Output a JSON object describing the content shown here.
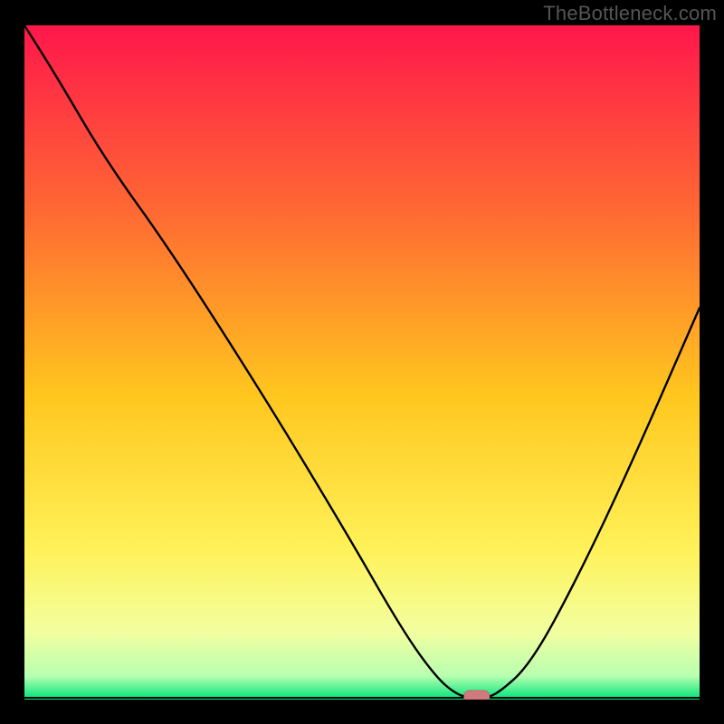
{
  "watermark": "TheBottleneck.com",
  "colors": {
    "page_bg": "#000000",
    "gradient_top": "#ff1f4b",
    "gradient_mid": "#ffd500",
    "gradient_low": "#f3ff8a",
    "gradient_green": "#00e37a",
    "curve": "#000000",
    "marker_fill": "#d07a7d",
    "marker_stroke": "#c06a6d"
  },
  "chart_data": {
    "type": "line",
    "title": "",
    "xlabel": "",
    "ylabel": "",
    "xlim": [
      0,
      100
    ],
    "ylim": [
      0,
      100
    ],
    "x": [
      0,
      5,
      12,
      22,
      36,
      48,
      56,
      61,
      64,
      66,
      68,
      70,
      75,
      82,
      90,
      100
    ],
    "values": [
      100,
      92,
      80,
      66,
      44,
      24,
      10,
      3,
      0.5,
      0,
      0,
      0.5,
      5,
      18,
      35,
      58
    ],
    "optimal_x": 67,
    "optimal_y": 0,
    "gradient_stops": [
      {
        "pos": 0.0,
        "color": "#ff174b"
      },
      {
        "pos": 0.28,
        "color": "#ff6a33"
      },
      {
        "pos": 0.55,
        "color": "#ffc71e"
      },
      {
        "pos": 0.78,
        "color": "#fff25a"
      },
      {
        "pos": 0.9,
        "color": "#f2ffa0"
      },
      {
        "pos": 0.965,
        "color": "#b8ffb0"
      },
      {
        "pos": 0.985,
        "color": "#4cf090"
      },
      {
        "pos": 1.0,
        "color": "#00e37a"
      }
    ]
  }
}
